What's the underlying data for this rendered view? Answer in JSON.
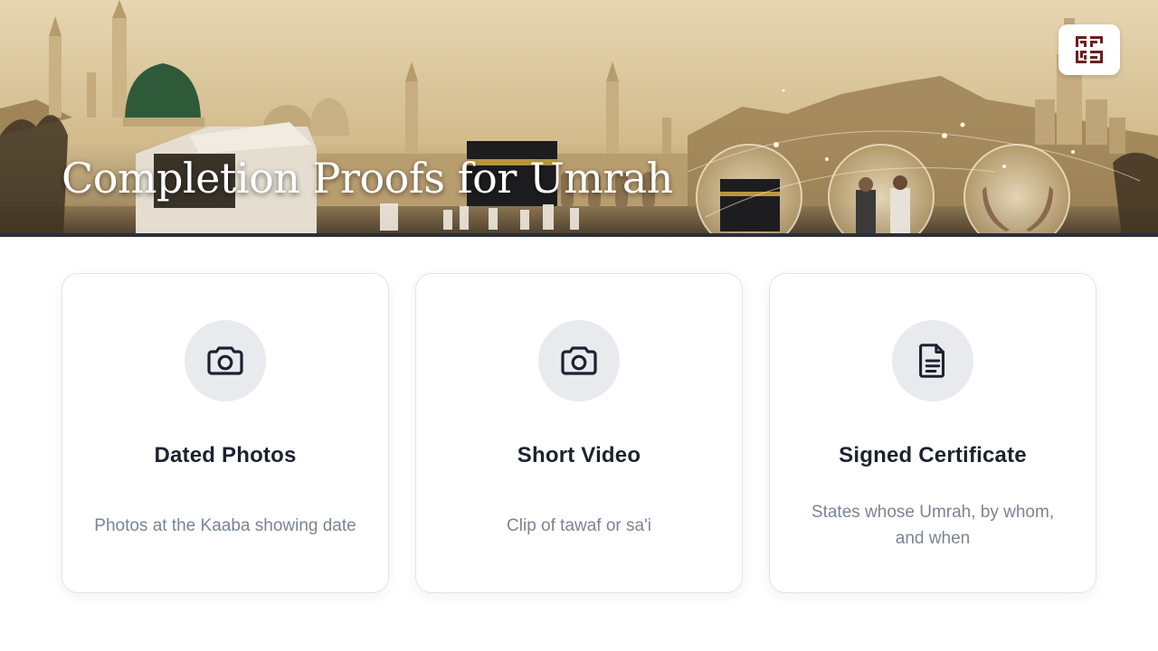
{
  "hero": {
    "title": "Completion Proofs for Umrah"
  },
  "logo": {
    "icon": "qr-logo-icon"
  },
  "cards": [
    {
      "icon": "camera-icon",
      "title": "Dated Photos",
      "description": "Photos at the Kaaba showing date"
    },
    {
      "icon": "camera-icon",
      "title": "Short Video",
      "description": "Clip of tawaf or sa'i"
    },
    {
      "icon": "document-icon",
      "title": "Signed Certificate",
      "description": "States whose Umrah, by whom, and when"
    }
  ],
  "colors": {
    "title_text": "#1c2230",
    "desc_text": "#7a8496",
    "icon_bg": "#e9eaee",
    "card_border": "#e2e4e8",
    "logo_maroon": "#6b1f1f"
  }
}
